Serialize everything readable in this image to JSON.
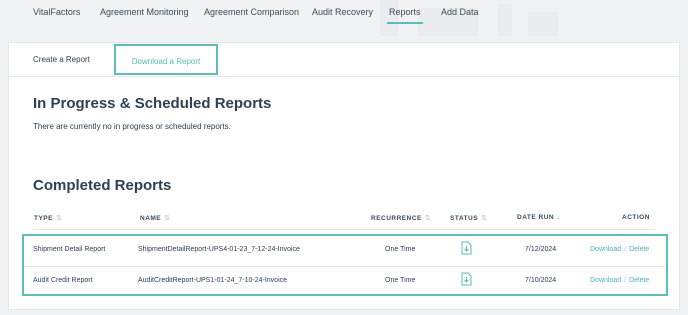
{
  "nav": {
    "items": [
      "VitalFactors",
      "Agreement Monitoring",
      "Agreement Comparison",
      "Audit Recovery",
      "Reports",
      "Add Data"
    ],
    "active": "Reports"
  },
  "tabs": {
    "create": "Create a Report",
    "download": "Download a Report",
    "active": "Download a Report"
  },
  "in_progress": {
    "title": "In Progress & Scheduled Reports",
    "message": "There are currently no in progress or scheduled reports."
  },
  "completed": {
    "title": "Completed Reports",
    "columns": {
      "type": "TYPE",
      "name": "NAME",
      "recurrence": "RECURRENCE",
      "status": "STATUS",
      "date_run": "DATE RUN",
      "action": "ACTION"
    },
    "rows": [
      {
        "type": "Shipment Detail Report",
        "name": "ShipmentDetailReport-UPS4-01-23_7-12-24-Invoice",
        "recurrence": "One Time",
        "status_icon": "download-file-icon",
        "date_run": "7/12/2024",
        "download": "Download",
        "separator": "/",
        "delete": "Delete"
      },
      {
        "type": "Audit Credit Report",
        "name": "AuditCreditReport-UPS1-01-24_7-10-24-Invoice",
        "recurrence": "One Time",
        "status_icon": "download-file-icon",
        "date_run": "7/10/2024",
        "download": "Download",
        "separator": "/",
        "delete": "Delete"
      }
    ]
  },
  "colors": {
    "accent": "#5bbcb8",
    "heading": "#2e4154",
    "background": "#f1f2f3"
  }
}
